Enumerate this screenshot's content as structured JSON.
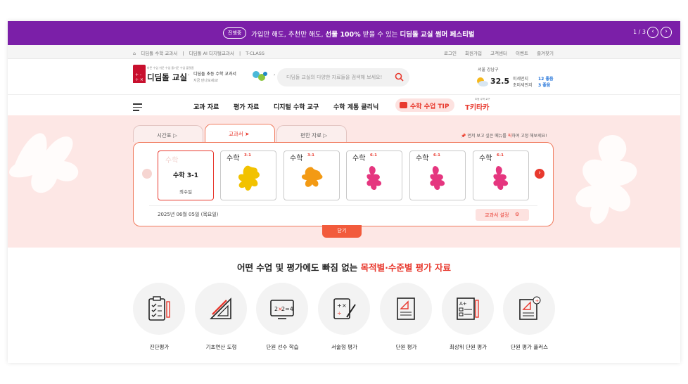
{
  "banner": {
    "badge": "진행중",
    "msg_prefix": "가입만 해도, 추천만 해도,",
    "msg_bold1": "선물 100%",
    "msg_mid": "받을 수 있는",
    "msg_bold2": "디딤돌 교실 썸머 페스티벌",
    "pager": "1 / 3",
    "prev": "‹",
    "next": "›"
  },
  "util": {
    "left": [
      "디딤돌 수학 교과서",
      "|",
      "디딤돌 AI 디지털교과서",
      "|",
      "T-CLASS"
    ],
    "right": [
      "로그인",
      "회원가입",
      "고객센터",
      "이벤트",
      "즐겨찾기"
    ]
  },
  "logo": {
    "tagline": "바른 수업 쉬운 수업 즐거운 수업 플랫폼",
    "name": "디딤돌 교실"
  },
  "promo": {
    "title": "디딤돌 초등 수학 교과서",
    "sub": "지금 만나보세요!"
  },
  "search": {
    "placeholder": "디딤돌 교실의 다양한 자료들을 검색해 보세요!"
  },
  "weather": {
    "location": "서울 강남구",
    "temp": "32.5",
    "dust_label": "미세먼지",
    "dust_value": "12 좋음",
    "fine_label": "초미세먼지",
    "fine_value": "3 좋음"
  },
  "nav": {
    "items": [
      "교과 자료",
      "평가 자료",
      "디지털 수학 교구",
      "수학 계통 클리닉"
    ],
    "tip": "수학 수업 TIP",
    "tkt_small": "초등 수학 교구",
    "tkt": "T키타카"
  },
  "tabs": [
    "시간표 ▷",
    "교과서 ➤",
    "편한 자료 ▷"
  ],
  "hint": {
    "pre": "먼저 보고 싶은 메뉴를",
    "em": "픽",
    "post": "하여 고정 해보세요!"
  },
  "cards": {
    "selected": {
      "name": "수학 3-1",
      "recent": "최수일",
      "ghost": "수학"
    },
    "items": [
      {
        "title": "수학",
        "grade": "3-1",
        "color": "#f2c200"
      },
      {
        "title": "수학",
        "grade": "3-1",
        "color": "#f39a14"
      },
      {
        "title": "수학",
        "grade": "6-1",
        "color": "#e5367f"
      },
      {
        "title": "수학",
        "grade": "6-1",
        "color": "#e5367f"
      },
      {
        "title": "수학",
        "grade": "6-1",
        "color": "#e5367f"
      }
    ]
  },
  "panel": {
    "date": "2025년 06월 05일 (목요일)",
    "settings": "교과서 설정"
  },
  "close": "닫기",
  "headline": {
    "pre": "어떤 수업 및 평가에도 빠짐 없는",
    "em": "목적별·수준별 평가 자료"
  },
  "tiles": [
    "진단평가",
    "기초연산 도형",
    "단원 선수 학습",
    "서술형 평가",
    "단원 평가",
    "최상위 단원 평가",
    "단원 평가 플러스"
  ],
  "colors": {
    "banner": "#7b1fa8",
    "accent": "#e8392e",
    "pink_bg": "#fde7e5"
  }
}
